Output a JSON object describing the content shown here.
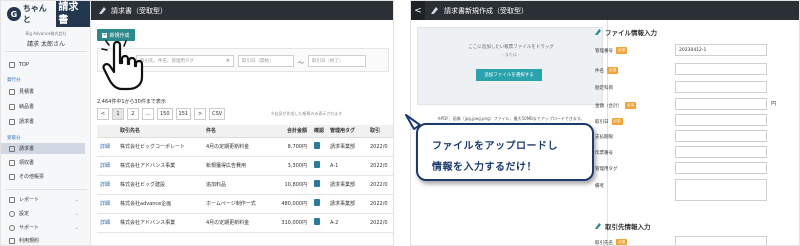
{
  "left": {
    "brand": {
      "part1": "ちゃんと",
      "part2": "請求書"
    },
    "company": "Big Advance株式会社",
    "username": "請求 太郎さん",
    "nav": {
      "top": "TOP",
      "issued_heading": "発行分",
      "issued": [
        "見積書",
        "納品書",
        "請求書"
      ],
      "received_heading": "受取分",
      "received": [
        "請求書",
        "領収書",
        "その他帳票"
      ],
      "bottom": [
        "レポート",
        "設定",
        "サポート",
        "利用規約"
      ]
    },
    "header_title": "請求書（受取型）",
    "new_button": "新規作成",
    "filter": {
      "keyword_placeholder": "取引先、件名、管理用タグ",
      "date_from_placeholder": "取引日（開始）",
      "date_to_placeholder": "取引日（終了）",
      "tilde": "〜",
      "clear": "×"
    },
    "results_count": "2,464件中1から30件まで表示",
    "pager": [
      "<",
      "1",
      "2",
      "...",
      "150",
      "151",
      ">",
      "CSV"
    ],
    "pager_note": "※自身が作成した帳票のみ表示されます",
    "table": {
      "columns": [
        "",
        "取引先名",
        "件名",
        "合計金額",
        "確認",
        "管理用タグ",
        "取引"
      ],
      "rows": [
        {
          "link": "詳細",
          "client": "株式会社ビッグコーポレート",
          "subject": "4月の定期更新料金",
          "amount": "8,700円",
          "tag": "請求事業部",
          "date": "2022/0"
        },
        {
          "link": "詳細",
          "client": "株式会社アドバンス事業",
          "subject": "新規獲得広告費用",
          "amount": "3,300円",
          "tag": "A-1",
          "date": "2022/0"
        },
        {
          "link": "詳細",
          "client": "株式会社ビッグ建設",
          "subject": "追加料品",
          "amount": "10,800円",
          "tag": "請求事業部",
          "date": "2022/0"
        },
        {
          "link": "詳細",
          "client": "株式会社advance企画",
          "subject": "ホームページ制作一式",
          "amount": "480,000円",
          "tag": "請求事業部",
          "date": "2022/0"
        },
        {
          "link": "詳細",
          "client": "株式会社アドバンス事業",
          "subject": "4月の定期更新料金",
          "amount": "310,000円",
          "tag": "A-2",
          "date": "2022/0"
        }
      ]
    }
  },
  "right": {
    "back": "<",
    "header_title": "請求書新規作成（受取型）",
    "dropzone": {
      "text": "ここに追加したい帳票ファイルをドラッグ",
      "or": "- または -",
      "button": "追加ファイルを選択する",
      "note": "※PDF、画像（jpg,jpeg,png）ファイル、最大50MBまでアップロードできます。"
    },
    "file_section_title": "ファイル情報入力",
    "fields": [
      {
        "label": "管理番号",
        "required": true,
        "value": "20230412-1"
      },
      {
        "label": "件名",
        "required": true,
        "value": ""
      },
      {
        "label": "勘定科目",
        "required": false,
        "value": ""
      },
      {
        "label": "金額（合計）",
        "required": true,
        "value": "",
        "unit": "円"
      },
      {
        "label": "取引日",
        "required": true,
        "value": ""
      },
      {
        "label": "支払期限",
        "required": false,
        "value": ""
      },
      {
        "label": "伝票番号",
        "required": false,
        "value": ""
      },
      {
        "label": "管理用タグ",
        "required": false,
        "value": ""
      },
      {
        "label": "備考",
        "required": false,
        "value": ""
      }
    ],
    "required_badge": "必須",
    "client_section_title": "取引先情報入力",
    "client_field": {
      "label": "取引先名",
      "required": true
    }
  },
  "callout": {
    "line1": "ファイルをアップロードし",
    "line2": "情報を入力するだけ！"
  },
  "colors": {
    "header": "#2b3037",
    "teal": "#2d8a8c",
    "callout": "#1c3a6e",
    "required": "#f0a43a"
  }
}
